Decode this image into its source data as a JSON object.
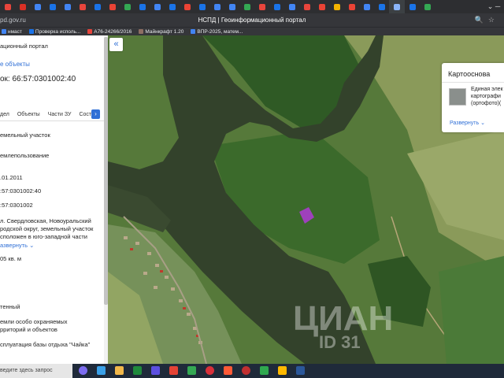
{
  "browser": {
    "url_fragment": "pd.gov.ru",
    "page_title": "НСПД | Геоинформационный портал",
    "tab_colors": [
      "#e8453c",
      "#d93025",
      "#4285f4",
      "#1a73e8",
      "#4285f4",
      "#e8453c",
      "#1a73e8",
      "#ea4335",
      "#34a853",
      "#1a73e8",
      "#4285f4",
      "#1a73e8",
      "#ea4335",
      "#1a73e8",
      "#4285f4",
      "#4285f4",
      "#34a853",
      "#e8453c",
      "#1a73e8",
      "#4285f4",
      "#e8453c",
      "#ea4335",
      "#f4b400",
      "#ea4335",
      "#4285f4",
      "#1a73e8",
      "#8ab4f8",
      "#1a73e8",
      "#34a853"
    ],
    "bookmarks": [
      {
        "label": "нмаст",
        "color": "#4285f4"
      },
      {
        "label": "Проверка исполь...",
        "color": "#1a73e8"
      },
      {
        "label": "А76-24266/2016",
        "color": "#e8453c"
      },
      {
        "label": "Майнкрафт 1.20",
        "color": "#8d6e63"
      },
      {
        "label": "ВПР-2025, матем...",
        "color": "#4285f4"
      }
    ]
  },
  "panel": {
    "header": "ационный портал",
    "back_link": "е объекты",
    "object_title": "ок: 66:57:0301002:40",
    "tabs": [
      "дел",
      "Объекты",
      "Части ЗУ",
      "Сост"
    ],
    "fields": [
      "емельный участок",
      "емлепользование",
      ".01.2011",
      ":57:0301002:40",
      ":57:0301002",
      "л. Свердловская, Новоуральский",
      "родской округ, земельный участок",
      "сположен в юго-западной части",
      "05 кв. м",
      "тенный",
      "емли особо охраняемых",
      "рриторий и объектов",
      "сплуатация базы отдыха \"Чайка\""
    ],
    "expand_link": "азвернуть"
  },
  "basemap": {
    "title": "Картооснова",
    "description_lines": [
      "Единая элек",
      "картографи",
      "(ортофото)("
    ],
    "expand_link": "Развернуть"
  },
  "watermark": {
    "brand": "ЦИАН",
    "id": "ID 31"
  },
  "taskbar": {
    "search_placeholder": "ведите здесь запрос",
    "app_colors": [
      "#7c6cf0",
      "#3aa0e8",
      "#f2b84b",
      "#1f8a3c",
      "#5c4fe0",
      "#e44335",
      "#34a853",
      "#d9303a",
      "#ff5a36",
      "#c13030",
      "#2fa84f",
      "#ffb900",
      "#2b579a"
    ]
  }
}
